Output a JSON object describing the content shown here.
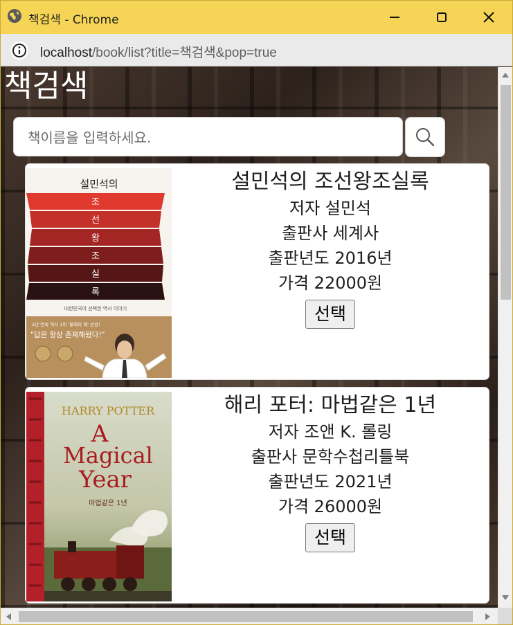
{
  "window": {
    "title": "책검색 - Chrome",
    "url_host": "localhost",
    "url_path": "/book/list?title=책검색&pop=true"
  },
  "page": {
    "heading": "책검색",
    "search_placeholder": "책이름을 입력하세요."
  },
  "books": [
    {
      "title": "설민석의 조선왕조실록",
      "author": "저자 설민석",
      "publisher": "출판사 세계사",
      "year": "출판년도 2016년",
      "price": "가격 22000원",
      "select_label": "선택",
      "cover": {
        "top_text": "설민석의",
        "bands": [
          "조",
          "선",
          "왕",
          "조",
          "실",
          "록"
        ],
        "subtitle": "대한민국이 선택한 역사 이야기",
        "banner_small": "2년 연속 역사 1위 '올해의 책' 선정!",
        "banner_big": "\"답은 항상 존재해왔다!\"",
        "colors": {
          "band1": "#e03a2f",
          "band2": "#c4302a",
          "band3": "#a32624",
          "band4": "#7d1d1c",
          "band5": "#561616",
          "band6": "#2a1212",
          "bottom": "#b8905e"
        }
      }
    },
    {
      "title": "해리 포터: 마법같은 1년",
      "author": "저자 조앤 K. 롤링",
      "publisher": "출판사 문학수첩리틀북",
      "year": "출판년도 2021년",
      "price": "가격 26000원",
      "select_label": "선택",
      "cover": {
        "series": "HARRY POTTER",
        "title_line1": "A",
        "title_line2": "Magical",
        "title_line3": "Year",
        "subtitle": "마법같은 1년",
        "colors": {
          "spine": "#b3202a",
          "sky": "#cfd6c8",
          "title": "#a81c20",
          "train": "#8a1e1a"
        }
      }
    }
  ]
}
